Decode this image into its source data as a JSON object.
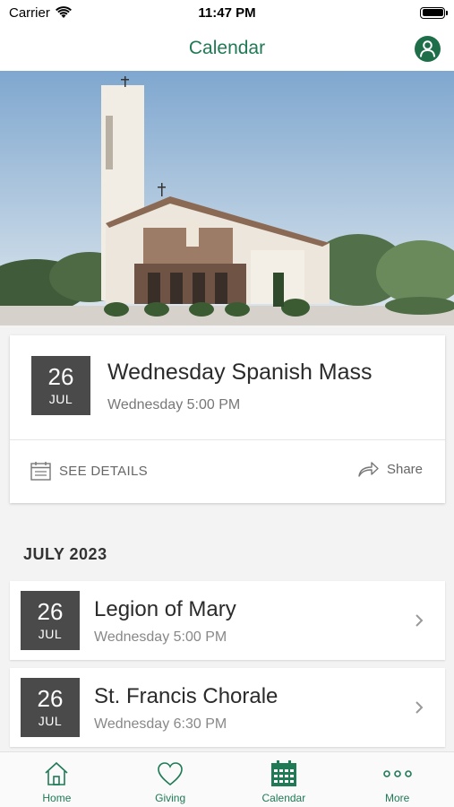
{
  "status_bar": {
    "carrier": "Carrier",
    "time": "11:47 PM"
  },
  "nav": {
    "title": "Calendar",
    "profile_icon": "user-icon"
  },
  "featured": {
    "day": "26",
    "month": "JUL",
    "title": "Wednesday Spanish Mass",
    "time": "Wednesday 5:00 PM",
    "details_label": "SEE DETAILS",
    "share_label": "Share"
  },
  "section": {
    "title": "JULY 2023"
  },
  "events": [
    {
      "day": "26",
      "month": "JUL",
      "title": "Legion of Mary",
      "time": "Wednesday 5:00 PM"
    },
    {
      "day": "26",
      "month": "JUL",
      "title": "St. Francis Chorale",
      "time": "Wednesday 6:30 PM"
    }
  ],
  "tabs": [
    {
      "label": "Home",
      "icon": "home-icon"
    },
    {
      "label": "Giving",
      "icon": "heart-icon"
    },
    {
      "label": "Calendar",
      "icon": "calendar-icon"
    },
    {
      "label": "More",
      "icon": "more-icon"
    }
  ],
  "colors": {
    "accent": "#1f7a55",
    "badge": "#4a4a4a",
    "background": "#f3f3f3"
  }
}
